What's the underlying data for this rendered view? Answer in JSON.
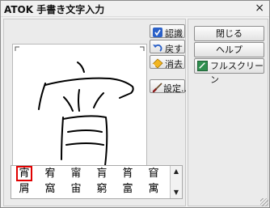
{
  "window": {
    "title": "ATOK 手書き文字入力",
    "close_glyph": "×"
  },
  "canvas": {
    "drawn_character": "宵"
  },
  "tools": {
    "recognize_label": "認識",
    "back_label": "戻す",
    "erase_label": "消去",
    "settings_label": "設定..."
  },
  "right_panel": {
    "close_label": "閉じる",
    "help_label": "ヘルプ",
    "fullscreen_label": "フルスクリーン"
  },
  "candidates": {
    "row1": [
      "宵",
      "宥",
      "甯",
      "肓",
      "筲",
      "窅"
    ],
    "row2": [
      "屑",
      "窩",
      "宙",
      "窮",
      "富",
      "寓"
    ],
    "selected_index": 0
  },
  "colors": {
    "selection": "#e00000",
    "recognize_icon": "#2a60c8",
    "back_icon": "#2a60c8",
    "erase_icon": "#f2b520",
    "fullscreen_icon": "#2f8f4f"
  },
  "icons": {
    "recognize": "recognize-icon",
    "back": "undo-arrow-icon",
    "erase": "eraser-icon",
    "settings": "brush-icon",
    "fullscreen": "fullscreen-icon",
    "resize": "resize-grip-icon"
  }
}
